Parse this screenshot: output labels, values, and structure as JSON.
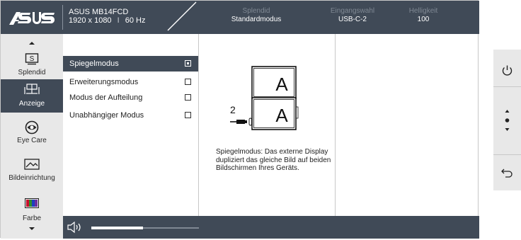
{
  "brand": {
    "logo_text": "/ISUS"
  },
  "header": {
    "model": "ASUS MB14FCD",
    "resolution": "1920 x 1080",
    "separator": "I",
    "refresh": "60 Hz",
    "columns": [
      {
        "key": "Splendid",
        "value": "Standardmodus"
      },
      {
        "key": "Eingangswahl",
        "value": "USB-C-2"
      },
      {
        "key": "Helligkeit",
        "value": "100"
      }
    ]
  },
  "sidebar": {
    "items": [
      {
        "label": "Splendid",
        "icon": "splendid-icon"
      },
      {
        "label": "Anzeige",
        "icon": "display-mode-icon"
      },
      {
        "label": "Eye Care",
        "icon": "eye-icon"
      },
      {
        "label": "Bildeinrichtung",
        "icon": "image-setup-icon"
      },
      {
        "label": "Farbe",
        "icon": "color-bars-icon"
      }
    ]
  },
  "options": [
    {
      "label": "Spiegelmodus",
      "checked": true
    },
    {
      "label": "Erweiterungsmodus",
      "checked": false
    },
    {
      "label": "Modus der Aufteilung",
      "checked": false
    },
    {
      "label": "Unabhängiger Modus",
      "checked": false
    }
  ],
  "preview": {
    "screen_top_letter": "A",
    "screen_bottom_letter": "A",
    "port_number": "2",
    "description": "Spiegelmodus: Das externe Display dupliziert das gleiche Bild auf beiden Bildschirmen Ihres Geräts."
  },
  "volume": {
    "level": 0.48
  },
  "controls": [
    "power-icon",
    "navigate-icon",
    "back-icon"
  ],
  "colors": {
    "bar": "#404a57",
    "panel": "#e8e8e8",
    "accent_text": "#ffffff"
  }
}
